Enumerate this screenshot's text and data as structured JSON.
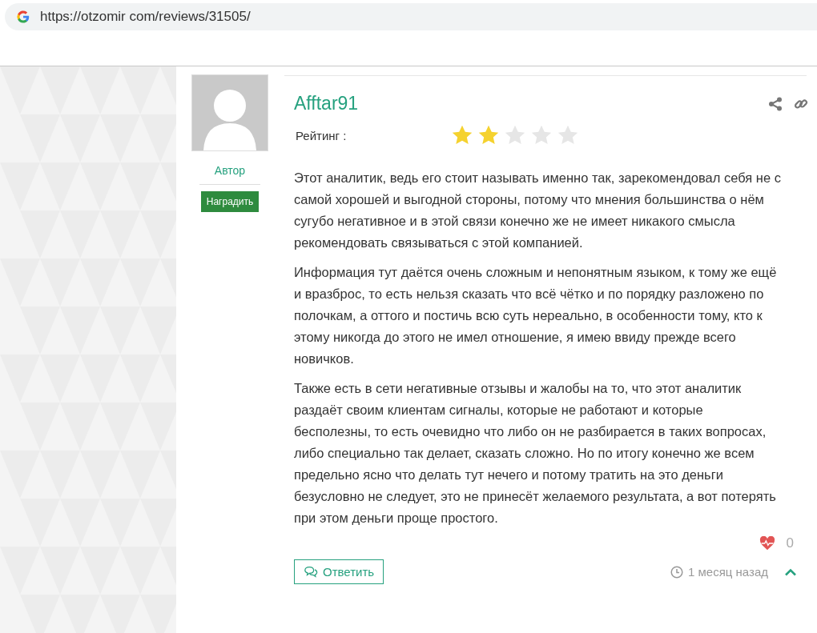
{
  "address_bar": {
    "url": "https://otzomir com/reviews/31505/"
  },
  "author": {
    "role": "Автор",
    "award_button": "Наградить"
  },
  "review": {
    "name": "Afftar91",
    "rating_label": "Рейтинг :",
    "stars": 2,
    "paragraphs": [
      "Этот аналитик, ведь его стоит называть именно так, зарекомендовал себя не с самой хорошей и выгодной стороны, потому что мнения большинства о нём сугубо негативное и в этой связи конечно же не имеет никакого смысла рекомендовать связываться с этой компанией.",
      "Информация тут даётся очень сложным и непонятным языком, к тому же ещё и вразброс, то есть нельзя сказать что всё чётко и по порядку разложено по полочкам, а оттого и постичь всю суть нереально, в особенности тому, кто к этому никогда до этого не имел отношение, я имею ввиду прежде всего новичков.",
      "Также есть в сети негативные отзывы и жалобы на то, что этот аналитик раздаёт своим клиентам сигналы, которые не работают и которые бесполезны, то есть очевидно что либо он не разбирается в таких вопросах, либо специально так делает, сказать сложно. Но по итогу конечно же всем предельно ясно что делать тут нечего и потому тратить на это деньги безусловно не следует, это не принесёт желаемого результата, а вот потерять при этом деньги проще простого."
    ],
    "likes": "0",
    "reply_button": "Ответить",
    "time": "1 месяц назад"
  }
}
